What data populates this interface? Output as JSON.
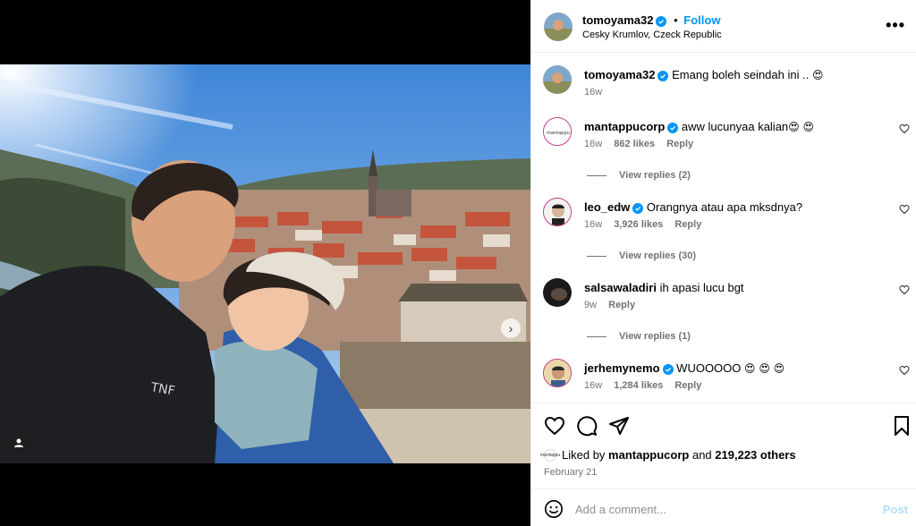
{
  "post": {
    "author": "tomoyama32",
    "follow_label": "Follow",
    "dot": "•",
    "location": "Cesky Krumlov, Czeck Republic",
    "more_label": "•••",
    "caption_text": "Emang boleh seindah ini ..",
    "caption_emoji": "😍",
    "caption_time": "16w",
    "photo_tag_count_dots": 3
  },
  "comments": [
    {
      "user": "mantappucorp",
      "verified": true,
      "text": "aww lucunyaa kalian",
      "emoji": "😍 😍",
      "time": "16w",
      "likes": "862 likes",
      "reply": "Reply",
      "view_replies": "View replies (2)"
    },
    {
      "user": "leo_edw",
      "verified": true,
      "text": "Orangnya atau apa mksdnya?",
      "emoji": "",
      "time": "16w",
      "likes": "3,926 likes",
      "reply": "Reply",
      "view_replies": "View replies (30)"
    },
    {
      "user": "salsawaladiri",
      "verified": false,
      "text": "ih apasi lucu bgt",
      "emoji": "",
      "time": "9w",
      "likes": "",
      "reply": "Reply",
      "view_replies": "View replies (1)"
    },
    {
      "user": "jerhemynemo",
      "verified": true,
      "text": "WUOOOOO",
      "emoji": "😍 😍 😍",
      "time": "16w",
      "likes": "1,284 likes",
      "reply": "Reply",
      "view_replies": ""
    }
  ],
  "likes_summary": {
    "prefix": "Liked by",
    "user": "mantappucorp",
    "and": "and",
    "others": "219,223 others",
    "mini_avatar_text": "mantappu"
  },
  "post_date": "February 21",
  "add_comment": {
    "placeholder": "Add a comment...",
    "post_label": "Post"
  },
  "icons": {
    "like": "heart-icon",
    "comment": "comment-icon",
    "share": "share-icon",
    "save": "bookmark-icon",
    "emoji": "emoji-icon"
  },
  "colors": {
    "link_blue": "#0095f6",
    "post_disabled": "#b2dffc",
    "meta_gray": "#737373"
  }
}
